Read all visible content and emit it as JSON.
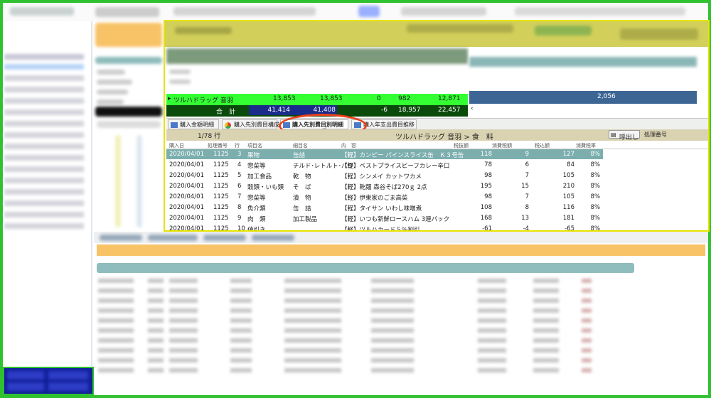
{
  "summary": {
    "row_name": "ツルハドラッグ 音羽",
    "row_values": [
      "13,853",
      "13,853",
      "0",
      "982",
      "12,871"
    ],
    "total_label": "合　計",
    "total_values": [
      "41,414",
      "41,408",
      "-6",
      "18,957",
      "22,457"
    ]
  },
  "right_panel": {
    "value": "2,056"
  },
  "tabs": [
    {
      "label": "購入金額明細",
      "icon": "grid-icon"
    },
    {
      "label": "購入先別費目構成",
      "icon": "pie-chart-icon"
    },
    {
      "label": "購入先別費目別明細",
      "icon": "grid-icon"
    },
    {
      "label": "購入年支出費目推移",
      "icon": "grid-icon"
    }
  ],
  "detail": {
    "count": "1/78 行",
    "breadcrumb": "ツルハドラッグ 音羽 > 食　料",
    "button_label": "呼出し",
    "number_label": "処理番号",
    "columns": [
      "購入日",
      "処理番号",
      "行",
      "項目名",
      "細目名",
      "内　容",
      "税抜額",
      "消費税額",
      "税込額",
      "消費税率"
    ],
    "rows": [
      {
        "date": "2020/04/01",
        "no": "1125",
        "line": "3",
        "item": "果物",
        "sub": "缶詰",
        "content": "【軽】カンピー パインスライス缶　Ｋ３号缶",
        "net": "118",
        "tax": "9",
        "gross": "127",
        "rate": "8%",
        "selected": true
      },
      {
        "date": "2020/04/01",
        "no": "1125",
        "line": "4",
        "item": "惣菜等",
        "sub": "チルド･レトルト･パウ",
        "content": "【軽】ベストプライスビーフカレー辛口",
        "net": "78",
        "tax": "6",
        "gross": "84",
        "rate": "8%",
        "selected": false
      },
      {
        "date": "2020/04/01",
        "no": "1125",
        "line": "5",
        "item": "加工食品",
        "sub": "乾　物",
        "content": "【軽】シンメイ カットワカメ",
        "net": "98",
        "tax": "7",
        "gross": "105",
        "rate": "8%",
        "selected": false
      },
      {
        "date": "2020/04/01",
        "no": "1125",
        "line": "6",
        "item": "穀類・いも類",
        "sub": "そ　ば",
        "content": "【軽】乾麺 森谷そば270ｇ 2点",
        "net": "195",
        "tax": "15",
        "gross": "210",
        "rate": "8%",
        "selected": false
      },
      {
        "date": "2020/04/01",
        "no": "1125",
        "line": "7",
        "item": "惣菜等",
        "sub": "漬　物",
        "content": "【軽】伊東家のごま高菜",
        "net": "98",
        "tax": "7",
        "gross": "105",
        "rate": "8%",
        "selected": false
      },
      {
        "date": "2020/04/01",
        "no": "1125",
        "line": "8",
        "item": "魚介類",
        "sub": "缶　詰",
        "content": "【軽】タイサン いわし味噌煮",
        "net": "108",
        "tax": "8",
        "gross": "116",
        "rate": "8%",
        "selected": false
      },
      {
        "date": "2020/04/01",
        "no": "1125",
        "line": "9",
        "item": "肉　類",
        "sub": "加工製品",
        "content": "【軽】いつも新鮮ロースハム 3連パック",
        "net": "168",
        "tax": "13",
        "gross": "181",
        "rate": "8%",
        "selected": false
      },
      {
        "date": "2020/04/01",
        "no": "1125",
        "line": "10",
        "item": "値引き",
        "sub": "",
        "content": "【軽】ツルハカード５％割引",
        "net": "-61",
        "tax": "-4",
        "gross": "-65",
        "rate": "8%",
        "selected": false
      }
    ]
  }
}
